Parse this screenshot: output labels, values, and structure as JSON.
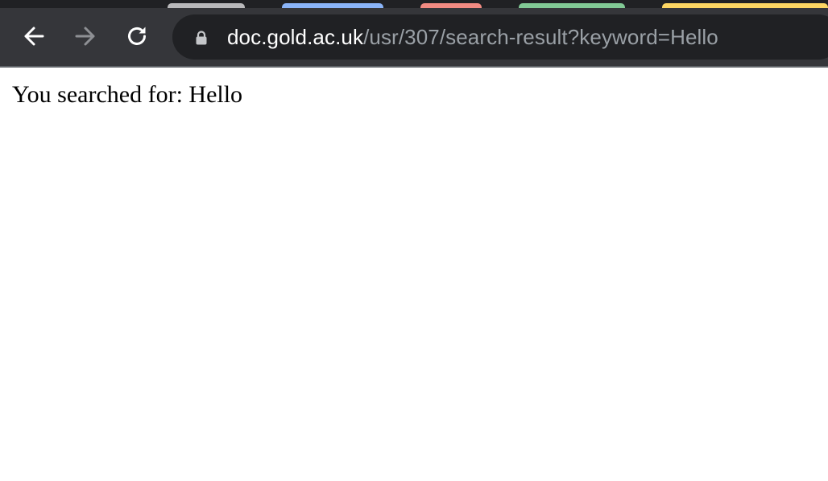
{
  "browser": {
    "tab_colors": [
      "#b9b9bb",
      "#8ab4f8",
      "#f28b82",
      "#81c995",
      "#fdd663"
    ],
    "nav": {
      "back_icon": "arrow-left-icon",
      "forward_icon": "arrow-right-icon",
      "reload_icon": "reload-icon"
    },
    "address_bar": {
      "icon": "lock-icon",
      "host": "doc.gold.ac.uk",
      "path": "/usr/307/search-result?keyword=Hello"
    }
  },
  "page": {
    "label": "You searched for:",
    "keyword": "Hello"
  }
}
